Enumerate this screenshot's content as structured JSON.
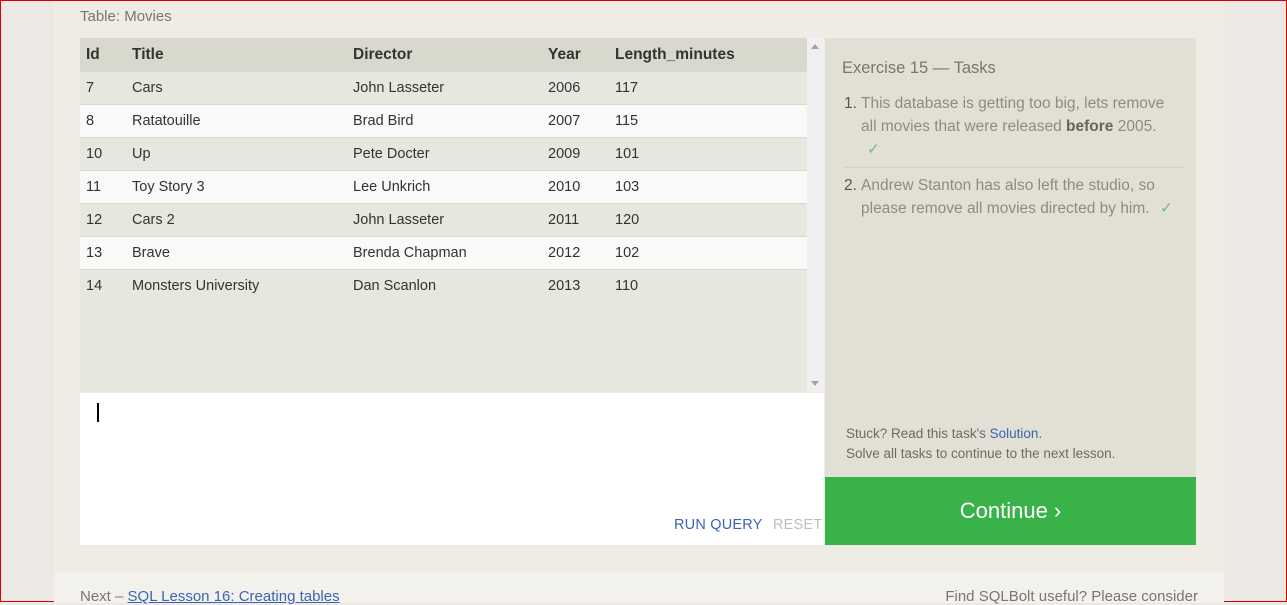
{
  "table_caption": "Table: Movies",
  "table": {
    "columns": [
      "Id",
      "Title",
      "Director",
      "Year",
      "Length_minutes"
    ],
    "rows": [
      [
        "7",
        "Cars",
        "John Lasseter",
        "2006",
        "117"
      ],
      [
        "8",
        "Ratatouille",
        "Brad Bird",
        "2007",
        "115"
      ],
      [
        "10",
        "Up",
        "Pete Docter",
        "2009",
        "101"
      ],
      [
        "11",
        "Toy Story 3",
        "Lee Unkrich",
        "2010",
        "103"
      ],
      [
        "12",
        "Cars 2",
        "John Lasseter",
        "2011",
        "120"
      ],
      [
        "13",
        "Brave",
        "Brenda Chapman",
        "2012",
        "102"
      ],
      [
        "14",
        "Monsters University",
        "Dan Scanlon",
        "2013",
        "110"
      ]
    ]
  },
  "editor": {
    "run_label": "RUN QUERY",
    "reset_label": "RESET"
  },
  "tasks": {
    "title": "Exercise 15 — Tasks",
    "items": [
      {
        "num": "1.",
        "text_before": "This database is getting too big, lets remove all movies that were released ",
        "bold": "before",
        "text_after": " 2005.",
        "check": "✓"
      },
      {
        "num": "2.",
        "text": "Andrew Stanton has also left the studio, so please remove all movies directed by him.",
        "check": "✓"
      }
    ],
    "stuck_prefix": "Stuck? Read this task's ",
    "solution_label": "Solution",
    "stuck_suffix": ".",
    "solve_all": "Solve all tasks to continue to the next lesson.",
    "continue_label": "Continue ›"
  },
  "footer": {
    "next_prefix": "Next – ",
    "next_link": "SQL Lesson 16: Creating tables",
    "right_text": "Find SQLBolt useful? Please consider"
  },
  "colors": {
    "accent": "#39b24a",
    "link": "#3a65b5",
    "check": "#71c47a"
  }
}
